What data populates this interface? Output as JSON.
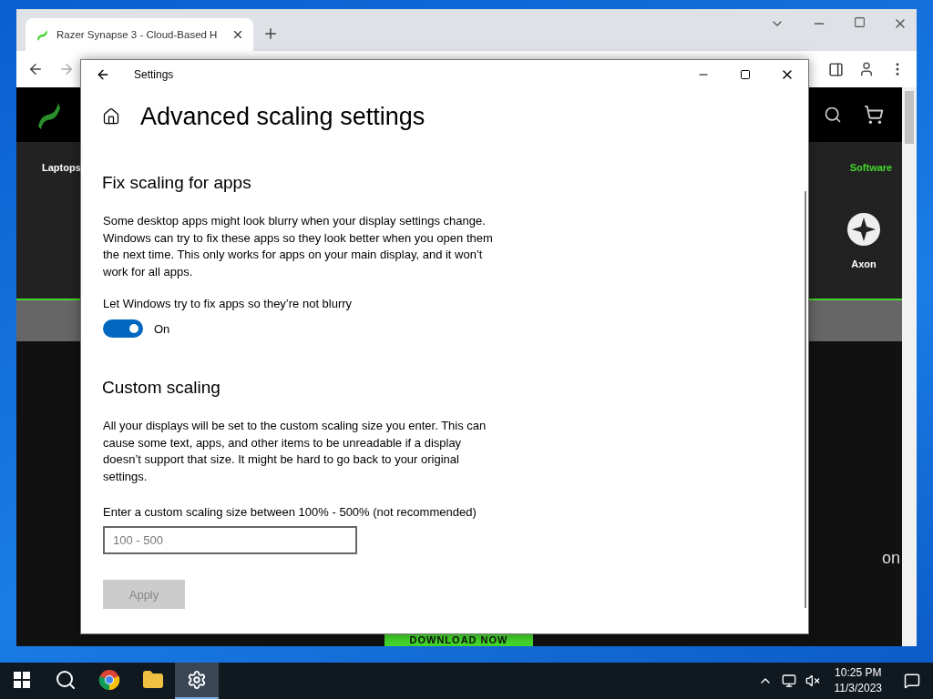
{
  "browser": {
    "tab_title": "Razer Synapse 3 - Cloud-Based H",
    "nav_left": "Laptops",
    "nav_right": "Software",
    "product": "Axon",
    "partial_text": "on",
    "download_button": "DOWNLOAD NOW"
  },
  "settings": {
    "title": "Settings",
    "heading": "Advanced scaling settings",
    "fix_section": {
      "heading": "Fix scaling for apps",
      "description": "Some desktop apps might look blurry when your display settings change. Windows can try to fix these apps so they look better when you open them the next time. This only works for apps on your main display, and it won’t work for all apps.",
      "toggle_label": "Let Windows try to fix apps so they’re not blurry",
      "toggle": {
        "on": true,
        "state_label": "On"
      }
    },
    "custom_section": {
      "heading": "Custom scaling",
      "description": "All your displays will be set to the custom scaling size you enter. This can cause some text, apps, and other items to be unreadable if a display doesn’t support that size. It might be hard to go back to your original settings.",
      "field_label": "Enter a custom scaling size between 100% - 500% (not recommended)",
      "field": {
        "placeholder": "100 - 500"
      },
      "apply_button": {
        "label": "Apply",
        "disabled": true
      }
    }
  },
  "taskbar": {
    "apps": [
      {
        "kind": "search",
        "selected": false
      },
      {
        "kind": "chrome",
        "selected": false
      },
      {
        "kind": "folder",
        "selected": false
      },
      {
        "kind": "settings",
        "selected": true
      }
    ],
    "time": "10:25 PM",
    "date": "11/3/2023"
  }
}
